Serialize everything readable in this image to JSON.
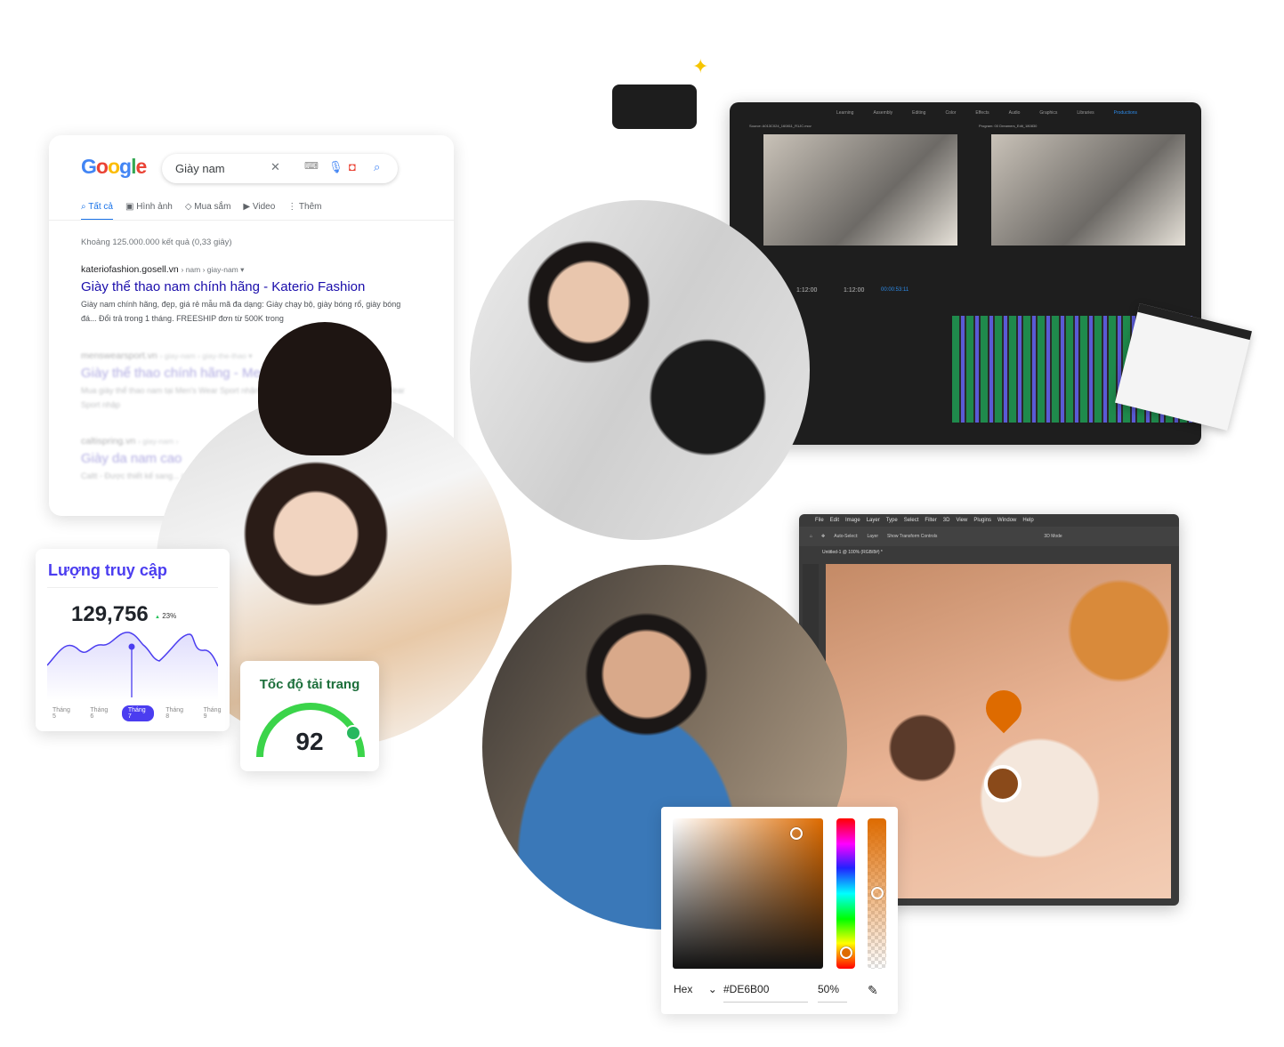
{
  "google": {
    "logo": "Google",
    "query": "Giày nam",
    "icons": [
      "close-icon",
      "keyboard-icon",
      "mic-icon",
      "camera-icon",
      "search-icon"
    ],
    "tabs": [
      {
        "label": "Tất cả",
        "active": true
      },
      {
        "label": "Hình ảnh"
      },
      {
        "label": "Mua sắm"
      },
      {
        "label": "Video"
      },
      {
        "label": "Thêm"
      }
    ],
    "stats": "Khoảng 125.000.000 kết quả (0,33 giây)",
    "results": [
      {
        "site": "kateriofashion.gosell.vn",
        "crumb": "› nam › giay-nam ▾",
        "title": "Giày thể thao nam chính hãng - Katerio Fashion",
        "snippet": "Giày nam chính hãng, đẹp, giá rẻ mẫu mã đa dạng: Giày chạy bộ, giày bóng rổ, giày bóng đá... Đổi trả trong 1 tháng. FREESHIP đơn từ 500K trong"
      },
      {
        "site": "menswearsport.vn",
        "crumb": "› giay-nam › giay-the-thao ▾",
        "title": "Giày thể thao chính hãng - Men's",
        "snippet": "Mua giày thể thao nam tại Men's Wear Sport nhận... thể thao chính hãng được Men's Wear Sport nhập"
      },
      {
        "site": "caltispring.vn",
        "crumb": "› giay-nam ›",
        "title": "Giày da nam cao",
        "snippet": "Caltt - Được thiết kế sang... giày da nam cao cấp"
      }
    ]
  },
  "premiere": {
    "workspaces": [
      "Learning",
      "Assembly",
      "Editing",
      "Color",
      "Effects",
      "Audio",
      "Graphics",
      "Libraries",
      "Productions"
    ],
    "active_workspace": "Productions",
    "source": "Source: A013C024_160811_R1JC.mov",
    "program": "Program: 00 Dreamers_Edit_180830",
    "timecodes": [
      "1:12:00",
      "1:12:00",
      "00:00:53:11"
    ]
  },
  "photoshop": {
    "menu": [
      "File",
      "Edit",
      "Image",
      "Layer",
      "Type",
      "Select",
      "Filter",
      "3D",
      "View",
      "Plugins",
      "Window",
      "Help"
    ],
    "options": [
      "Auto-Select:",
      "Layer",
      "Show Transform Controls",
      "3D Mode"
    ],
    "doc_tab": "Untitled-1 @ 100% (RGB/8#) *"
  },
  "traffic": {
    "title": "Lượng truy cập",
    "value": "129,756",
    "change": "23%",
    "months": [
      "Tháng 5",
      "Tháng 6",
      "Tháng 7",
      "Tháng 8",
      "Tháng 9"
    ],
    "selected_month": "Tháng 7",
    "accent": "#4B3DF0"
  },
  "speed": {
    "title": "Tốc độ tải trang",
    "score": "92",
    "color": "#3BD44A"
  },
  "color_picker": {
    "mode": "Hex",
    "hex": "#DE6B00",
    "opacity": "50%"
  }
}
